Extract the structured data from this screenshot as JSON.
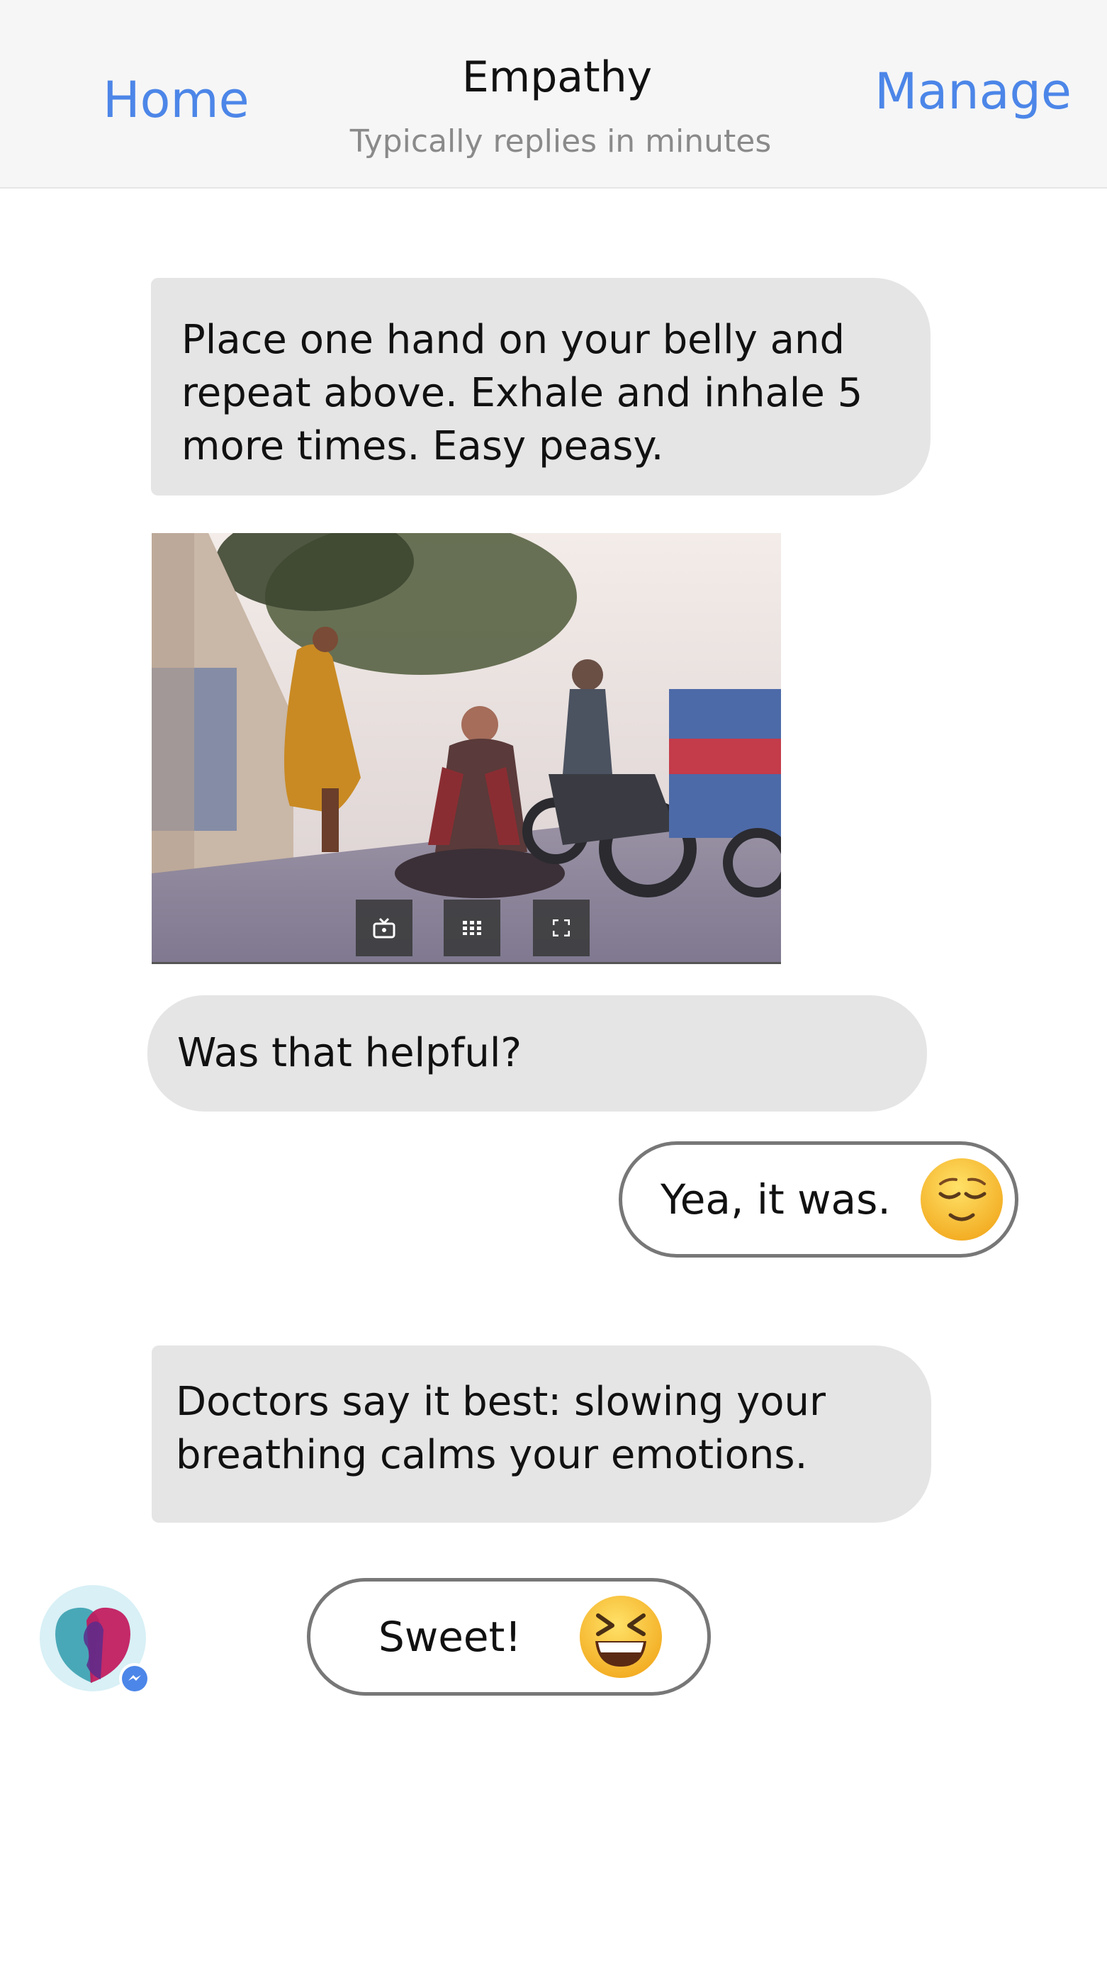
{
  "header": {
    "left_nav": "Home",
    "title": "Empathy",
    "subtitle": "Typically replies in minutes",
    "right_nav": "Manage"
  },
  "colors": {
    "accent": "#4c86e8",
    "incoming_bubble": "#e6e5e6",
    "outgoing_border": "#777777",
    "header_bg": "#f6f6f6"
  },
  "messages": [
    {
      "from": "bot",
      "type": "text",
      "text": "Place one hand on your belly and repeat above. Exhale and inhale 5 more times. Easy peasy."
    },
    {
      "from": "bot",
      "type": "image",
      "media_buttons": [
        "tv-icon",
        "grid-icon",
        "fullscreen-icon"
      ]
    },
    {
      "from": "bot",
      "type": "text",
      "text": "Was that helpful?"
    },
    {
      "from": "user",
      "type": "quick_reply",
      "text": "Yea, it was.",
      "emoji": "relieved-face-emoji"
    },
    {
      "from": "bot",
      "type": "text",
      "text": "Doctors say it best: slowing your breathing calms your emotions."
    },
    {
      "from": "user",
      "type": "quick_reply",
      "text": "Sweet!",
      "emoji": "grinning-squinting-face-emoji"
    }
  ],
  "avatar": {
    "icon": "empathy-logo-icon",
    "badge": "messenger-icon"
  }
}
